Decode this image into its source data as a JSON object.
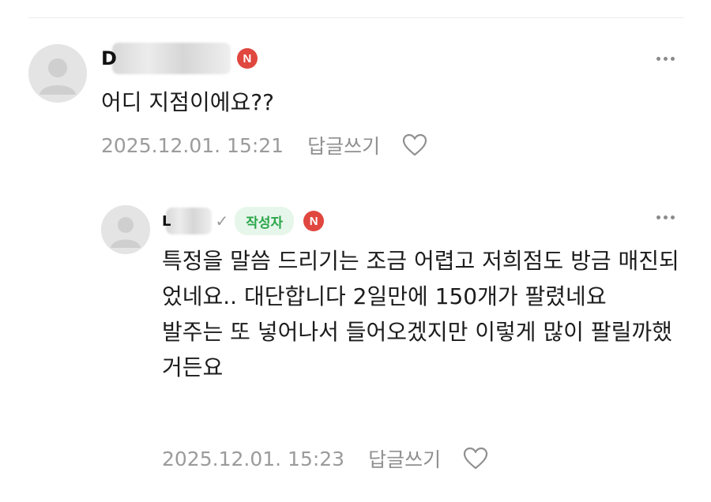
{
  "comments": [
    {
      "author_initial": "D",
      "badge": "N",
      "text": "어디 지점이에요??",
      "timestamp": "2025.12.01. 15:21",
      "reply_label": "답글쓰기",
      "like_icon": "heart-outline-icon",
      "more_icon": "more-dots-icon"
    },
    {
      "author_initial": "L",
      "author_tag": "작성자",
      "badge": "N",
      "text": "특정을 말씀 드리기는 조금 어렵고 저희점도 방금 매진되었네요.. 대단합니다 2일만에 150개가 팔렸네요\n발주는 또 넣어나서 들어오겠지만 이렇게 많이 팔릴까했거든요",
      "timestamp": "2025.12.01. 15:23",
      "reply_label": "답글쓰기",
      "like_icon": "heart-outline-icon",
      "more_icon": "more-dots-icon"
    }
  ],
  "colors": {
    "badge_red": "#e0473f",
    "author_green": "#2aa64a",
    "author_bg": "#e7f6ea",
    "meta_gray": "#9b9b9b"
  }
}
